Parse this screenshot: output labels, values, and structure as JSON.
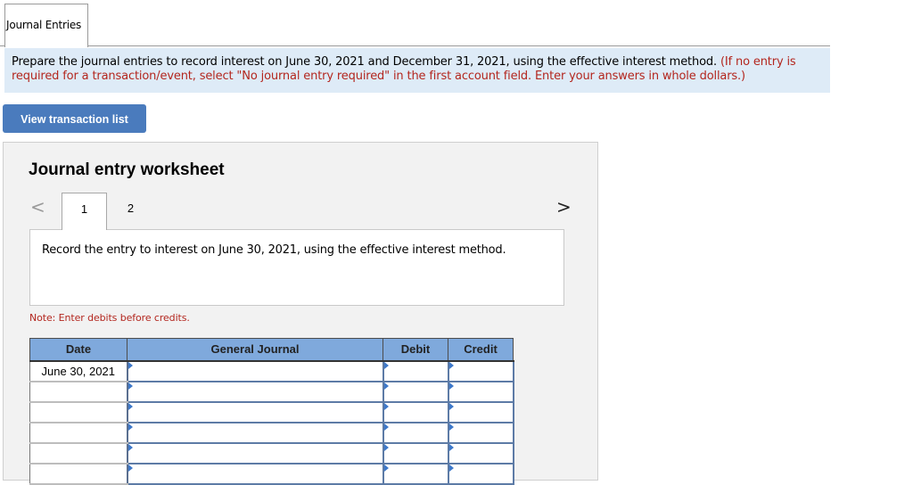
{
  "tabs": [
    {
      "label": "Journal Entries",
      "active": true
    }
  ],
  "instructions": {
    "main": "Prepare the journal entries to record interest on June 30, 2021 and December 31, 2021, using the effective interest method.",
    "note": "(If no entry is required for a transaction/event, select \"No journal entry required\" in the first account field. Enter your answers in whole dollars.)"
  },
  "view_button": {
    "label": "View transaction list"
  },
  "worksheet": {
    "title": "Journal entry worksheet",
    "prev_icon": "<",
    "next_icon": ">",
    "steps": [
      {
        "label": "1",
        "active": true
      },
      {
        "label": "2",
        "active": false
      }
    ],
    "prompt": "Record the entry to interest on June 30, 2021, using the effective interest method.",
    "note": "Note: Enter debits before credits."
  },
  "table": {
    "headers": {
      "date": "Date",
      "general_journal": "General Journal",
      "debit": "Debit",
      "credit": "Credit"
    },
    "rows": [
      {
        "date": "June 30, 2021",
        "account": "",
        "debit": "",
        "credit": ""
      },
      {
        "date": "",
        "account": "",
        "debit": "",
        "credit": ""
      },
      {
        "date": "",
        "account": "",
        "debit": "",
        "credit": ""
      },
      {
        "date": "",
        "account": "",
        "debit": "",
        "credit": ""
      },
      {
        "date": "",
        "account": "",
        "debit": "",
        "credit": ""
      },
      {
        "date": "",
        "account": "",
        "debit": "",
        "credit": ""
      }
    ]
  },
  "colors": {
    "accent_blue": "#4a7bbd",
    "header_blue": "#7fa9dc",
    "instruction_bg": "#deebf7",
    "red_text": "#b3261e"
  }
}
